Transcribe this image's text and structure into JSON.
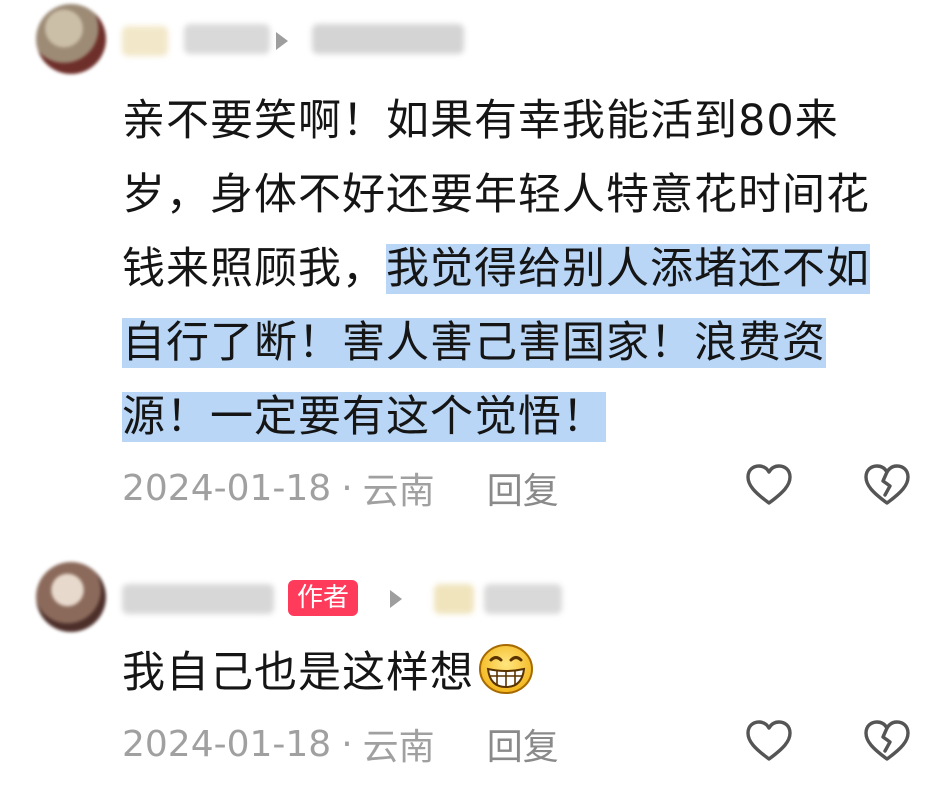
{
  "comments": [
    {
      "text_plain": "亲不要笑啊！如果有幸我能活到80来岁，身体不好还要年轻人特意花时间花钱来照顾我，",
      "text_highlight": "我觉得给别人添堵还不如自行了断！害人害己害国家！浪费资源！一定要有这个觉悟！",
      "date": "2024-01-18",
      "location": "云南",
      "reply_label": "回复"
    },
    {
      "author_badge": "作者",
      "text_plain": "我自己也是这样想",
      "emoji": "grinning-face",
      "date": "2024-01-18",
      "location": "云南",
      "reply_label": "回复"
    }
  ],
  "colors": {
    "highlight": "#b9d6f6",
    "badge": "#ff3b5c",
    "meta": "#a0a0a0"
  },
  "icons": [
    "heart-outline",
    "heart-broken"
  ]
}
